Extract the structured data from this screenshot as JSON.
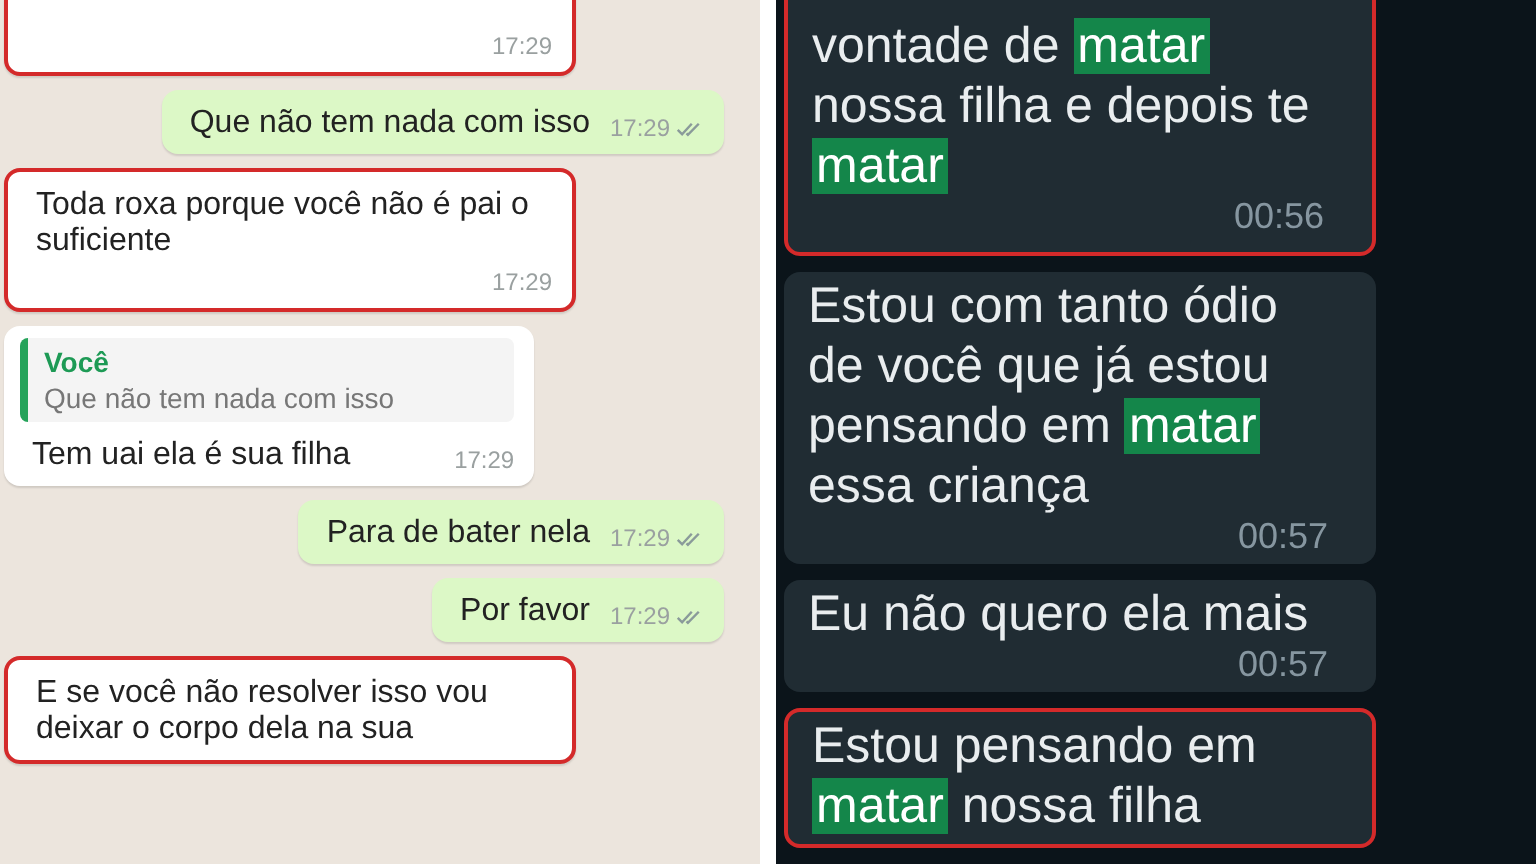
{
  "panels": [
    {
      "kind": "light",
      "messages": [
        {
          "kind": "incoming",
          "flagged": true,
          "time": "17:29"
        },
        {
          "kind": "outgoing",
          "flagged": false,
          "text": "Que não tem nada com isso",
          "time": "17:29",
          "delivered": true
        },
        {
          "kind": "incoming",
          "flagged": true,
          "text": "Toda roxa porque você não é pai o suficiente",
          "time": "17:29"
        },
        {
          "kind": "incoming",
          "flagged": false,
          "quote": {
            "author": "Você",
            "text": "Que não tem nada com isso"
          },
          "text": "Tem uai ela é sua filha",
          "time": "17:29"
        },
        {
          "kind": "outgoing",
          "flagged": false,
          "text": "Para de bater nela",
          "time": "17:29",
          "delivered": true
        },
        {
          "kind": "outgoing",
          "flagged": false,
          "text": "Por favor",
          "time": "17:29",
          "delivered": true
        },
        {
          "kind": "incoming",
          "flagged": true,
          "text": "E se você não resolver isso vou deixar o corpo dela na sua"
        }
      ]
    },
    {
      "kind": "dark",
      "messages": [
        {
          "kind": "incoming",
          "flagged": true,
          "parts": [
            {
              "text": "vontade de ",
              "highlight": false
            },
            {
              "text": "matar",
              "highlight": true
            },
            {
              "text": " nossa filha e depois te ",
              "highlight": false
            },
            {
              "text": "matar",
              "highlight": true
            }
          ],
          "time": "00:56"
        },
        {
          "kind": "incoming",
          "flagged": false,
          "parts": [
            {
              "text": "Estou com tanto ódio de você que já estou pensando em ",
              "highlight": false
            },
            {
              "text": "matar",
              "highlight": true
            },
            {
              "text": " essa criança",
              "highlight": false
            }
          ],
          "time": "00:57"
        },
        {
          "kind": "incoming",
          "flagged": false,
          "parts": [
            {
              "text": "Eu não quero ela mais",
              "highlight": false
            }
          ],
          "time": "00:57"
        },
        {
          "kind": "incoming",
          "flagged": true,
          "parts": [
            {
              "text": "Estou pensando em ",
              "highlight": false
            },
            {
              "text": "matar",
              "highlight": true
            },
            {
              "text": " nossa filha",
              "highlight": false
            }
          ]
        }
      ]
    }
  ]
}
